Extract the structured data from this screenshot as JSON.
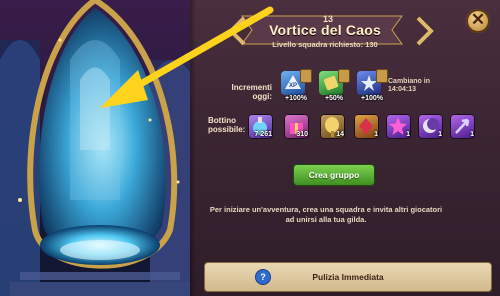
{
  "title_number": "13",
  "title": "Vortice del Caos",
  "required_level": "Livello squadra richiesto: 130",
  "increments": {
    "label": "Incrementi oggi:",
    "items": [
      {
        "icon": "team-xp-icon",
        "percent": "+100%"
      },
      {
        "icon": "gold-tome-icon",
        "percent": "+50%"
      },
      {
        "icon": "stars-icon",
        "percent": "+100%"
      }
    ],
    "change_label": "Cambiano in",
    "change_time": "14:04:13"
  },
  "loot": {
    "label_line1": "Bottino",
    "label_line2": "possibile:",
    "items": [
      {
        "icon": "experience-potion-icon",
        "qty": "7 261"
      },
      {
        "icon": "gift-box-icon",
        "qty": "310"
      },
      {
        "icon": "golden-mirror-icon",
        "qty": "14"
      },
      {
        "icon": "ruby-artifact-icon",
        "qty": "1"
      },
      {
        "icon": "purple-star-icon",
        "qty": "1"
      },
      {
        "icon": "moon-sigil-icon",
        "qty": "1"
      },
      {
        "icon": "dark-arrow-icon",
        "qty": "1"
      }
    ]
  },
  "create_group_button": "Crea gruppo",
  "description": "Per iniziare un'avventura, crea una squadra e invita altri giocatori ad unirsi alla tua gilda.",
  "bottom_button": "Pulizia Immediata",
  "help_label": "?",
  "close_label": "✕",
  "colors": {
    "panel": "#3b2533",
    "green_button": "#5fb538",
    "arrow": "#ffd21c",
    "text_light": "#f3e4c7"
  }
}
